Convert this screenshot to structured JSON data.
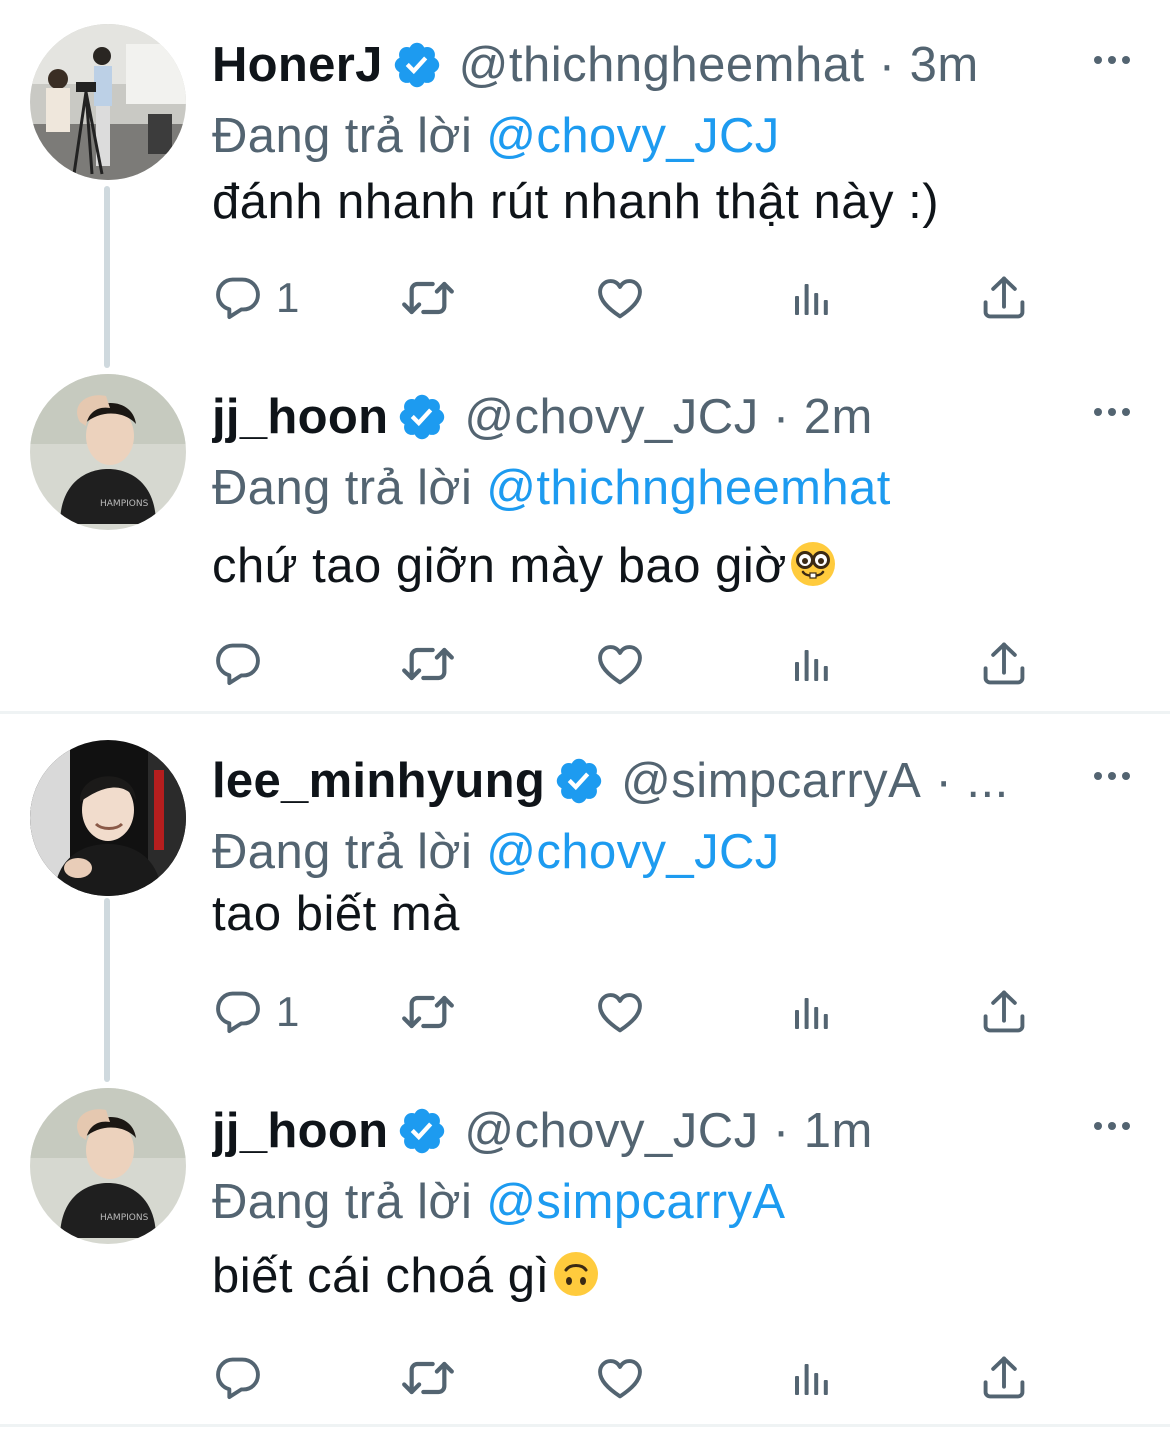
{
  "reply_prefix": "Đang trả lời",
  "colors": {
    "link": "#1d9bf0",
    "muted": "#536471",
    "text": "#0f1419",
    "verified": "#1d9bf0"
  },
  "tweets": [
    {
      "name": "HonerJ",
      "handle": "@thichngheemhat",
      "time": "· 3m",
      "replying_to": "@chovy_JCJ",
      "text": "đánh nhanh rút nhanh thật này :)",
      "reply_count": "1",
      "emoji": ""
    },
    {
      "name": "jj_hoon",
      "handle": "@chovy_JCJ",
      "time": "· 2m",
      "replying_to": "@thichngheemhat",
      "text": "chứ tao giỡn mày bao giờ",
      "reply_count": "",
      "emoji": "nerd-face"
    },
    {
      "name": "lee_minhyung",
      "handle": "@simpcarryA",
      "time": "· ...",
      "replying_to": "@chovy_JCJ",
      "text": "tao biết mà",
      "reply_count": "1",
      "emoji": ""
    },
    {
      "name": "jj_hoon",
      "handle": "@chovy_JCJ",
      "time": "· 1m",
      "replying_to": "@simpcarryA",
      "text": "biết cái choá gì",
      "reply_count": "",
      "emoji": "upside-down-face"
    }
  ]
}
